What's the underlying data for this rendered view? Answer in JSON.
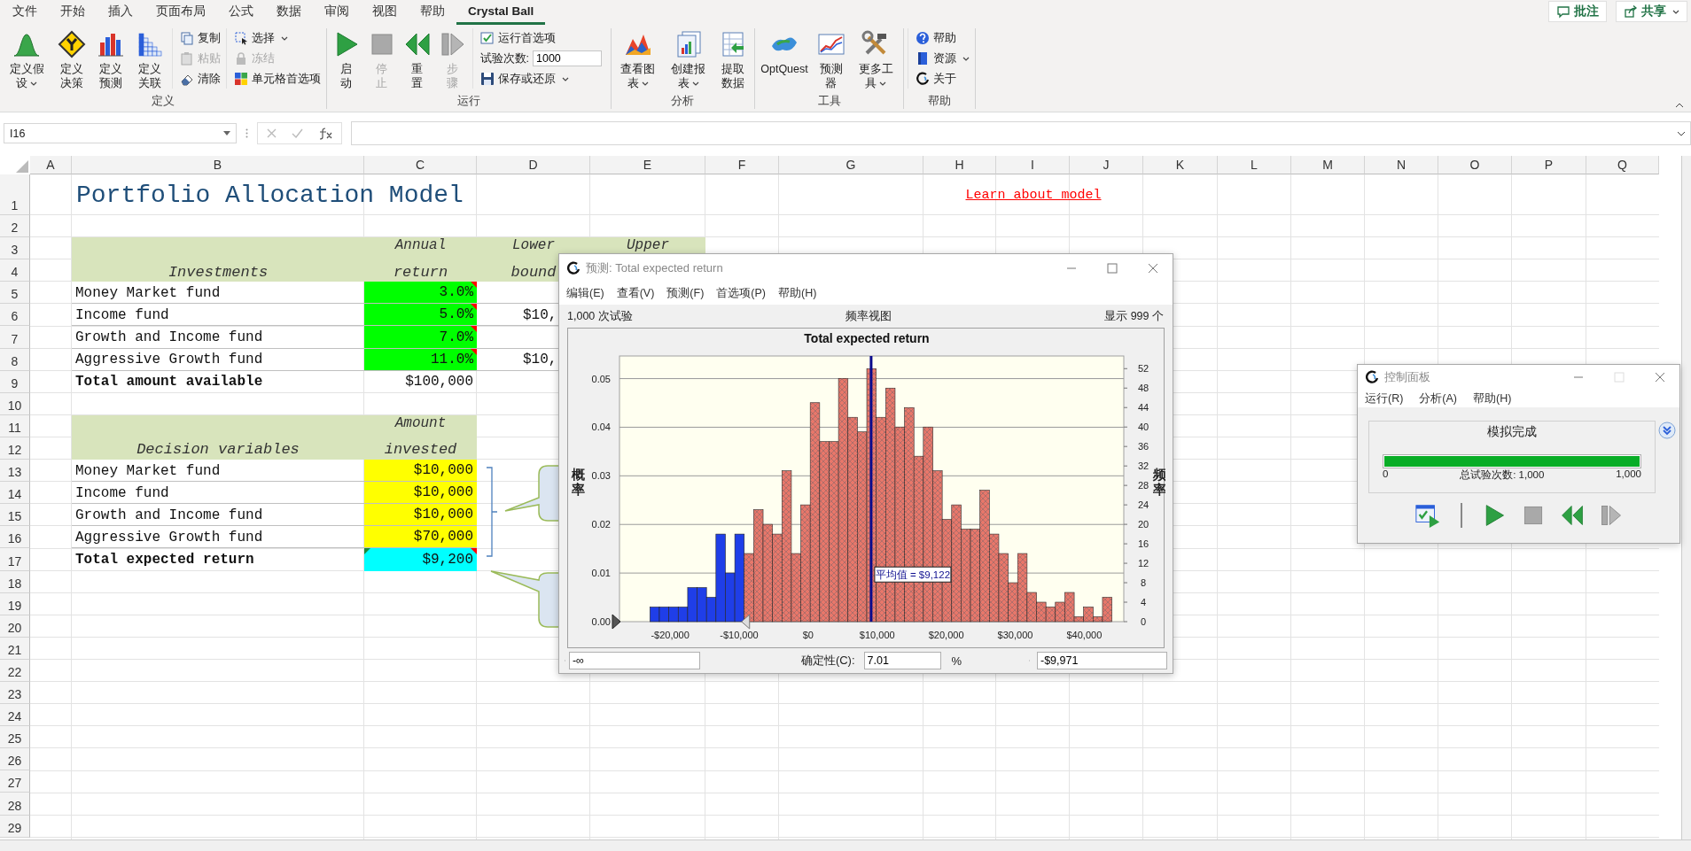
{
  "ribbon_tabs": [
    {
      "label": "文件",
      "selected": false
    },
    {
      "label": "开始",
      "selected": false
    },
    {
      "label": "插入",
      "selected": false
    },
    {
      "label": "页面布局",
      "selected": false
    },
    {
      "label": "公式",
      "selected": false
    },
    {
      "label": "数据",
      "selected": false
    },
    {
      "label": "审阅",
      "selected": false
    },
    {
      "label": "视图",
      "selected": false
    },
    {
      "label": "帮助",
      "selected": false
    },
    {
      "label": "Crystal Ball",
      "selected": true
    }
  ],
  "account_buttons": [
    {
      "label": "批注",
      "caret": false
    },
    {
      "label": "共享",
      "caret": true
    }
  ],
  "ribbon_groups": [
    {
      "label": "定义",
      "items": [
        {
          "kind": "large",
          "label": "定义假设",
          "caret": true,
          "disabled": false
        },
        {
          "kind": "large",
          "label": "定义决策",
          "caret": false,
          "disabled": false
        },
        {
          "kind": "large",
          "label": "定义预测",
          "caret": false,
          "disabled": false
        },
        {
          "kind": "large",
          "label": "定义关联",
          "caret": false,
          "disabled": false
        },
        {
          "kind": "stack",
          "items": [
            {
              "kind": "button",
              "label": "复制",
              "caret": false,
              "disabled": false
            },
            {
              "kind": "button",
              "label": "粘贴",
              "caret": false,
              "disabled": true
            },
            {
              "kind": "button",
              "label": "清除",
              "caret": false,
              "disabled": false
            }
          ]
        },
        {
          "kind": "stack",
          "items": [
            {
              "kind": "button",
              "label": "选择",
              "caret": true,
              "disabled": false
            },
            {
              "kind": "button",
              "label": "冻结",
              "caret": false,
              "disabled": true
            },
            {
              "kind": "button",
              "label": "单元格首选项",
              "caret": false,
              "disabled": false
            }
          ]
        }
      ]
    },
    {
      "label": "运行",
      "items": [
        {
          "kind": "large",
          "label": "启动",
          "caret": false,
          "disabled": false
        },
        {
          "kind": "large",
          "label": "停止",
          "caret": false,
          "disabled": true
        },
        {
          "kind": "large",
          "label": "重置",
          "caret": false,
          "disabled": false
        },
        {
          "kind": "large",
          "label": "步骤",
          "caret": false,
          "disabled": true
        },
        {
          "kind": "stack",
          "items": [
            {
              "kind": "button",
              "label": "运行首选项",
              "caret": false,
              "disabled": false
            },
            {
              "kind": "field",
              "label": "试验次数:",
              "value": "1000"
            },
            {
              "kind": "button",
              "label": "保存或还原",
              "caret": true,
              "disabled": false
            }
          ]
        }
      ]
    },
    {
      "label": "分析",
      "items": [
        {
          "kind": "large",
          "label": "查看图表",
          "caret": true,
          "disabled": false
        },
        {
          "kind": "large",
          "label": "创建报表",
          "caret": true,
          "disabled": false
        },
        {
          "kind": "large",
          "label": "提取数据",
          "caret": false,
          "disabled": false
        }
      ]
    },
    {
      "label": "工具",
      "items": [
        {
          "kind": "large",
          "label": "OptQuest",
          "caret": false,
          "disabled": false
        },
        {
          "kind": "large",
          "label": "预测器",
          "caret": false,
          "disabled": false
        },
        {
          "kind": "large",
          "label": "更多工具",
          "caret": true,
          "disabled": false
        }
      ]
    },
    {
      "label": "帮助",
      "items": [
        {
          "kind": "stack",
          "items": [
            {
              "kind": "button",
              "label": "帮助",
              "caret": false,
              "disabled": false
            },
            {
              "kind": "button",
              "label": "资源",
              "caret": true,
              "disabled": false
            },
            {
              "kind": "button",
              "label": "关于",
              "caret": false,
              "disabled": false
            }
          ]
        }
      ]
    }
  ],
  "formula_bar": {
    "name_box": "I16"
  },
  "sheet": {
    "column_headers": [
      "A",
      "B",
      "C",
      "D",
      "E",
      "F",
      "G",
      "H",
      "I",
      "J",
      "K",
      "L",
      "M",
      "N",
      "O",
      "P",
      "Q"
    ],
    "row_headers": [
      "1",
      "2",
      "3",
      "4",
      "5",
      "6",
      "7",
      "8",
      "9",
      "10",
      "11",
      "12",
      "13",
      "14",
      "15",
      "16",
      "17",
      "18",
      "19",
      "20",
      "21",
      "22",
      "23",
      "24",
      "25",
      "26",
      "27",
      "28",
      "29"
    ],
    "title": "Portfolio Allocation Model",
    "link": "Learn about model",
    "investments": {
      "heading": "Investments",
      "columns": [
        {
          "line_1": "Annual",
          "line_2": "return"
        },
        {
          "line_1": "Lower",
          "line_2": "bound"
        },
        {
          "line_1": "Upper"
        }
      ],
      "rows": [
        {
          "name": "Money Market fund",
          "return": "3.0%",
          "comment_mark": true
        },
        {
          "name": "Income fund",
          "return": "5.0%",
          "lower": "$10,",
          "comment_mark": true
        },
        {
          "name": "Growth and Income fund",
          "return": "7.0%",
          "comment_mark": true
        },
        {
          "name": "Aggressive Growth fund",
          "return": "11.0%",
          "lower": "$10,",
          "comment_mark": true
        }
      ],
      "total": {
        "label": "Total amount available",
        "value": "$100,000"
      }
    },
    "decisions": {
      "heading": "Decision variables",
      "column": {
        "line_1": "Amount",
        "line_2": "invested"
      },
      "rows": [
        {
          "name": "Money Market fund",
          "amount": "$10,000"
        },
        {
          "name": "Income fund",
          "amount": "$10,000"
        },
        {
          "name": "Growth and Income fund",
          "amount": "$10,000"
        },
        {
          "name": "Aggressive Growth fund",
          "amount": "$70,000"
        }
      ],
      "total": {
        "label": "Total expected return",
        "value": "$9,200",
        "comment_mark": true,
        "error_mark": true
      }
    }
  },
  "forecast_window": {
    "title": "预测: Total expected return",
    "menu": [
      "编辑(E)",
      "查看(V)",
      "预测(F)",
      "首选项(P)",
      "帮助(H)"
    ],
    "trials": "1,000 次试验",
    "view": "频率视图",
    "shown": "显示 999 个",
    "probability_axis": {
      "label": "概率",
      "ticks": [
        "0.05",
        "0.04",
        "0.03",
        "0.02",
        "0.01",
        "0.00"
      ]
    },
    "chart_data": {
      "type": "bar",
      "title": "Total expected return",
      "ylabel": "频率",
      "x": [
        -22240,
        -20874,
        -19508,
        -18142,
        -16776,
        -15410,
        -14044,
        -12678,
        -11312,
        -9946,
        -8580,
        -7214,
        -5848,
        -4482,
        -3116,
        -1750,
        -384,
        982,
        2348,
        3714,
        5080,
        6446,
        7812,
        9178,
        10544,
        11910,
        13276,
        14642,
        16008,
        17374,
        18740,
        20106,
        21472,
        22838,
        24204,
        25570,
        26936,
        28302,
        29668,
        31034,
        32400,
        33766,
        35132,
        36498,
        37864,
        39230,
        40596,
        41962,
        43328
      ],
      "series": [
        {
          "color": "#1f3ee8",
          "values": [
            3,
            3,
            3,
            3,
            7,
            7,
            5,
            18,
            10,
            18,
            null,
            null,
            null,
            null,
            null,
            null,
            null,
            null,
            null,
            null,
            null,
            null,
            null,
            null,
            null,
            null,
            null,
            null,
            null,
            null,
            null,
            null,
            null,
            null,
            null,
            null,
            null,
            null,
            null,
            null,
            null,
            null,
            null,
            null,
            null,
            null,
            null,
            null,
            null
          ]
        },
        {
          "color": "#e8776a",
          "values": [
            null,
            null,
            null,
            null,
            null,
            null,
            null,
            null,
            null,
            null,
            14,
            23,
            20,
            18,
            31,
            14,
            24,
            45,
            37,
            37,
            50,
            42,
            39,
            52,
            42,
            48,
            40,
            44,
            34,
            40,
            31,
            21,
            24,
            19,
            19,
            27,
            18,
            14,
            8,
            14,
            6,
            4,
            3,
            4,
            6,
            1,
            3,
            1,
            5
          ]
        }
      ],
      "xlim": [
        -27335,
        45730
      ],
      "ylim": [
        0,
        54.6
      ],
      "xticks": [
        {
          "value": -20000,
          "label": "-$20,000"
        },
        {
          "value": -10000,
          "label": "-$10,000"
        },
        {
          "value": 0,
          "label": "$0"
        },
        {
          "value": 10000,
          "label": "$10,000"
        },
        {
          "value": 20000,
          "label": "$20,000"
        },
        {
          "value": 30000,
          "label": "$30,000"
        },
        {
          "value": 40000,
          "label": "$40,000"
        }
      ],
      "yticks": [
        0,
        4,
        8,
        12,
        16,
        20,
        24,
        28,
        32,
        36,
        40,
        44,
        48,
        52
      ],
      "ref_lines": [
        {
          "axis": "x",
          "value": 9122
        }
      ],
      "annotations": [
        {
          "x": 9122,
          "y": 9.6,
          "text": "平均值 = $9,122"
        }
      ]
    },
    "certainty": {
      "lower": "-∞",
      "label": "确定性(C):",
      "value": "7.01",
      "unit": "%",
      "upper": "-$9,971"
    }
  },
  "control_panel": {
    "title": "控制面板",
    "menu": [
      "运行(R)",
      "分析(A)",
      "帮助(H)"
    ],
    "status": "模拟完成",
    "progress": {
      "level": 1,
      "min": "0",
      "caption": "总试验次数: 1,000",
      "max": "1,000"
    }
  }
}
